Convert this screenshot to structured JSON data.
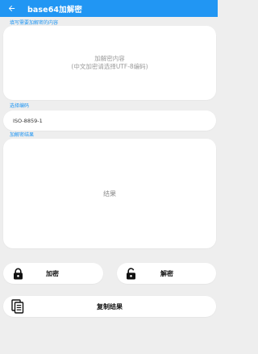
{
  "app": {
    "title": "base64加解密",
    "back_icon": "arrow-left-icon"
  },
  "input_section": {
    "label": "填写需要加解密的内容",
    "placeholder_line1": "加解密内容",
    "placeholder_line2": "(中文加密请选择UTF-8编码)"
  },
  "encoding_section": {
    "label": "选择编码",
    "selected": "ISO-8859-1"
  },
  "result_section": {
    "label": "加解密结果",
    "placeholder": "结果"
  },
  "buttons": {
    "encrypt": {
      "label": "加密",
      "icon": "lock-closed-icon"
    },
    "decrypt": {
      "label": "解密",
      "icon": "lock-open-icon"
    },
    "copy": {
      "label": "复制结果",
      "icon": "copy-document-icon"
    }
  },
  "colors": {
    "primary": "#2196f3",
    "background": "#eeeeee",
    "card": "#ffffff",
    "placeholder": "#9a9a9a"
  }
}
